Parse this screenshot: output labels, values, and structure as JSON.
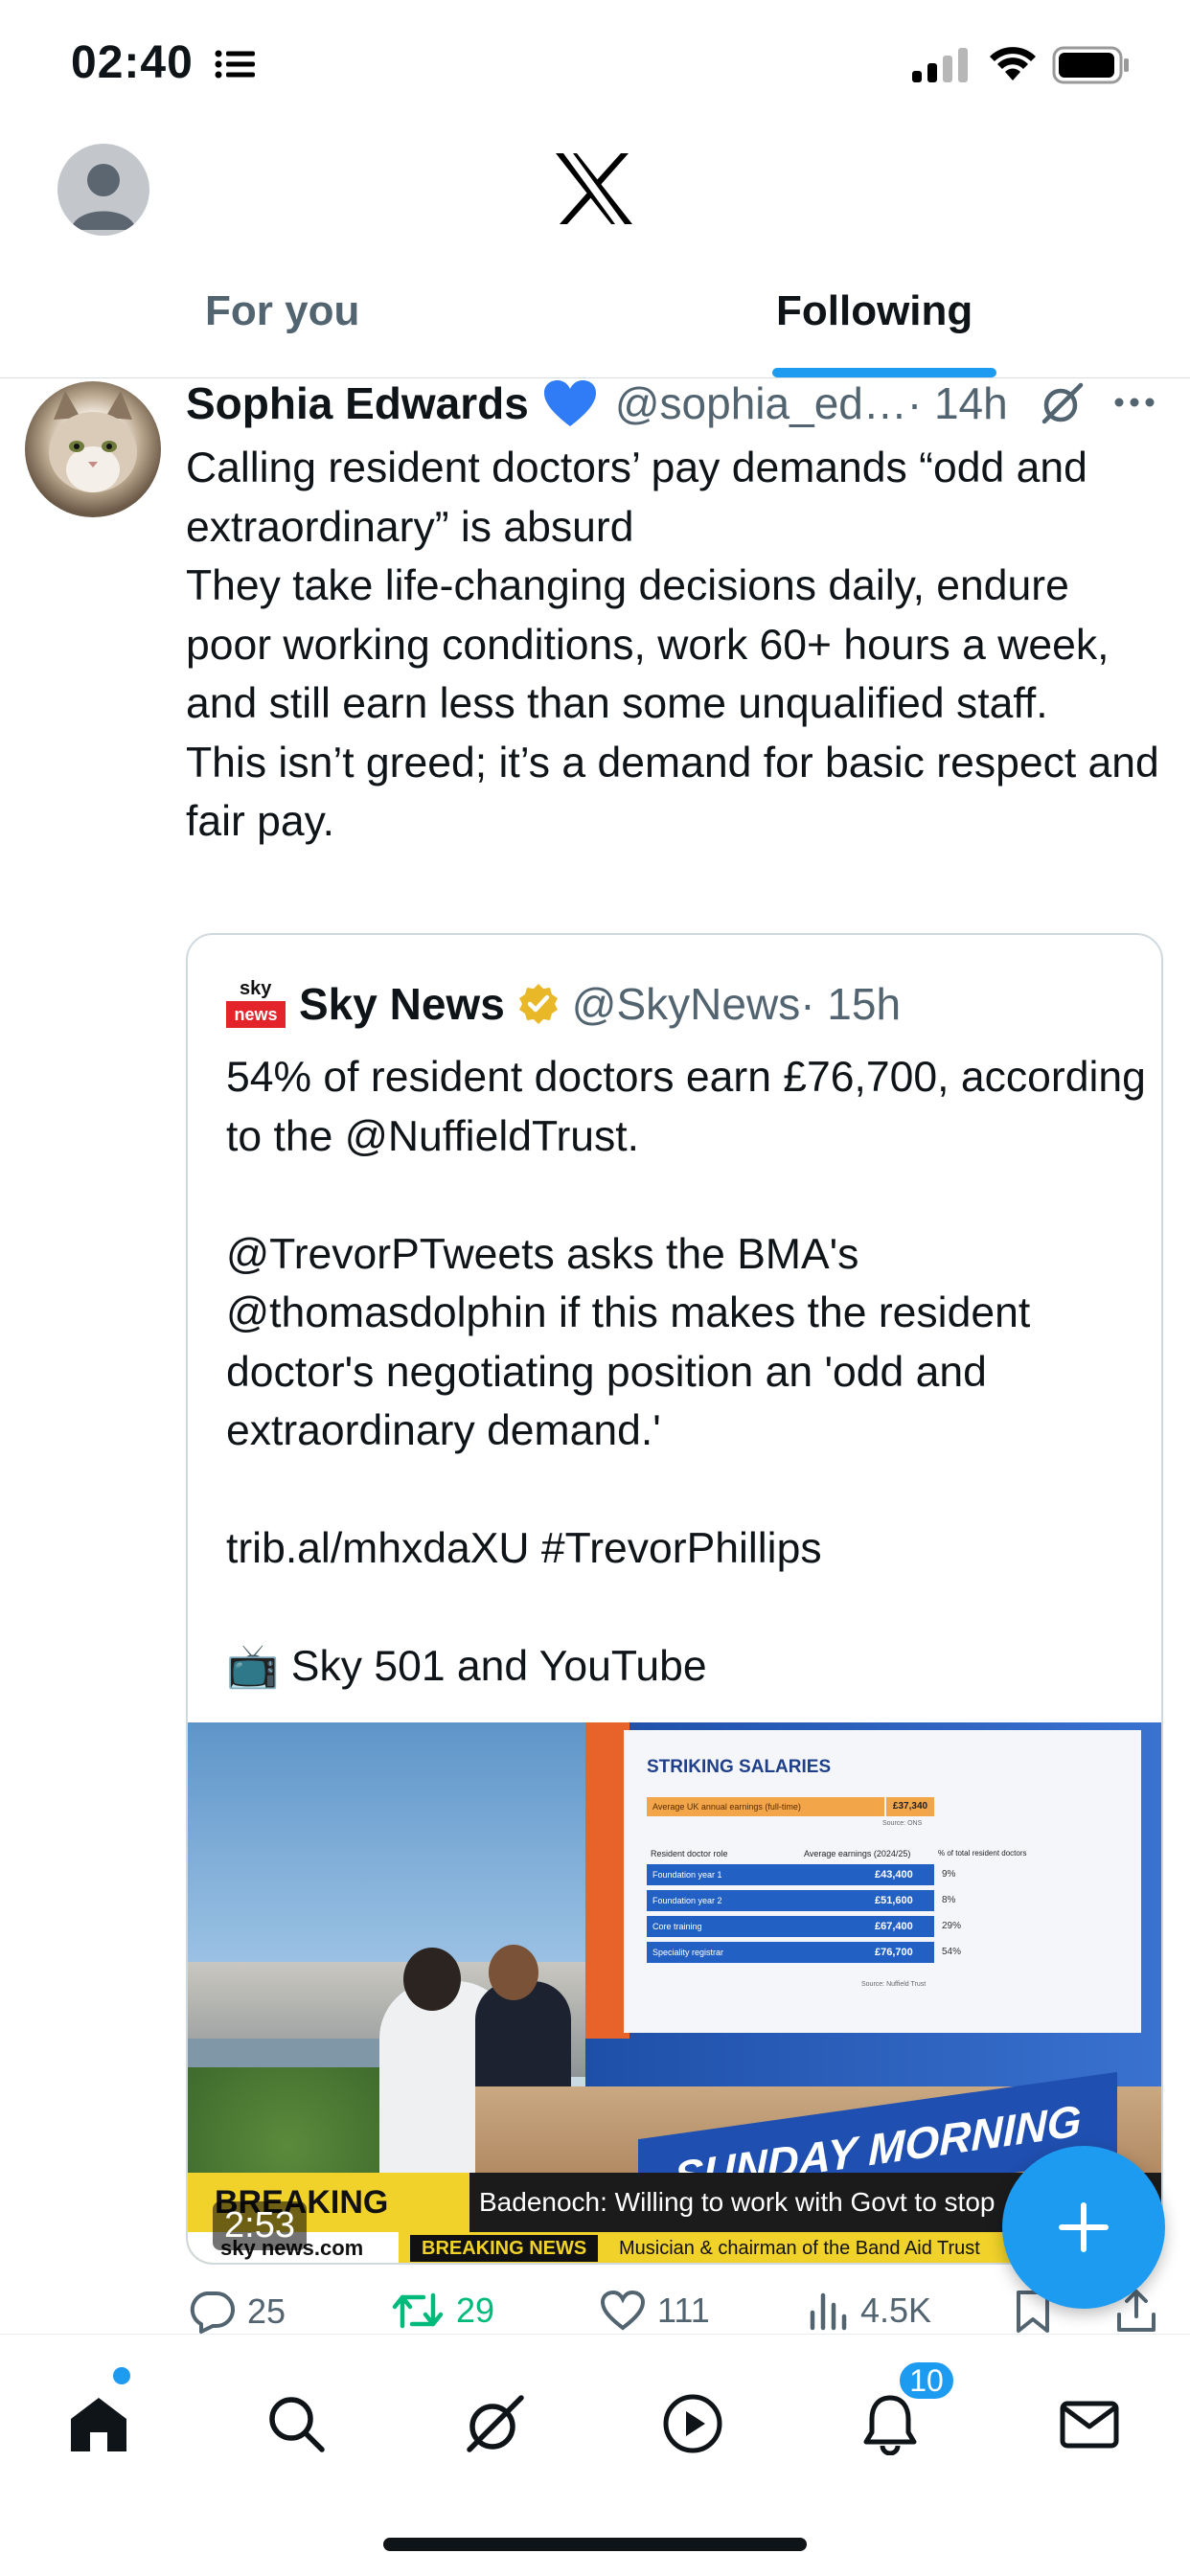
{
  "status_bar": {
    "time": "02:40"
  },
  "header": {
    "tabs": [
      {
        "label": "For you",
        "active": false
      },
      {
        "label": "Following",
        "active": true
      }
    ]
  },
  "tweet": {
    "author_name": "Sophia Edwards",
    "handle": "@sophia_ed…",
    "time": "· 14h",
    "text": "Calling resident doctors’ pay demands “odd and extraordinary” is absurd\nThey take life-changing decisions daily, endure poor working conditions, work 60+ hours a week, and still earn less than some unqualified staff.\nThis isn’t greed; it’s a demand for basic respect and fair pay.",
    "quote": {
      "logo_top": "sky",
      "logo_bottom": "news",
      "author_name": "Sky News",
      "handle": "@SkyNews",
      "time": "· 15h",
      "text": "54% of resident doctors earn £76,700, according to the @NuffieldTrust.\n\n@TrevorPTweets asks the BMA's @thomasdolphin if this makes the resident doctor's negotiating position an 'odd and extraordinary demand.'\n\ntrib.al/mhxdaXU #TrevorPhillips\n\n📺 Sky 501 and YouTube",
      "video": {
        "duration": "2:53",
        "screen": {
          "title": "STRIKING SALARIES",
          "uk_label": "Average UK annual earnings (full-time)",
          "uk_value": "£37,340",
          "uk_source": "Source: ONS",
          "col_role": "Resident doctor role",
          "col_earnings": "Average earnings (2024/25)",
          "col_pct": "% of total resident doctors",
          "rows": [
            {
              "role": "Foundation year 1",
              "earnings": "£43,400",
              "pct": "9%"
            },
            {
              "role": "Foundation year 2",
              "earnings": "£51,600",
              "pct": "8%"
            },
            {
              "role": "Core training",
              "earnings": "£67,400",
              "pct": "29%"
            },
            {
              "role": "Speciality registrar",
              "earnings": "£76,700",
              "pct": "54%"
            }
          ],
          "source": "Source: Nuffield Trust"
        },
        "desk_text": "SUNDAY MORNING",
        "ticker_label": "BREAKING NEWS",
        "ticker_text": "Badenoch: Willing to work with Govt to stop",
        "ticker2_label": "BREAKING NEWS",
        "ticker2_text": "Musician & chairman of the Band Aid Trust",
        "channel": "sky news.com"
      }
    },
    "actions": {
      "replies": "25",
      "reposts": "29",
      "likes": "111",
      "views": "4.5K"
    }
  },
  "nav": {
    "notifications_badge": "10"
  },
  "colors": {
    "accent": "#1d9bf0",
    "repost_active": "#00ba7c",
    "text_secondary": "#536471"
  }
}
